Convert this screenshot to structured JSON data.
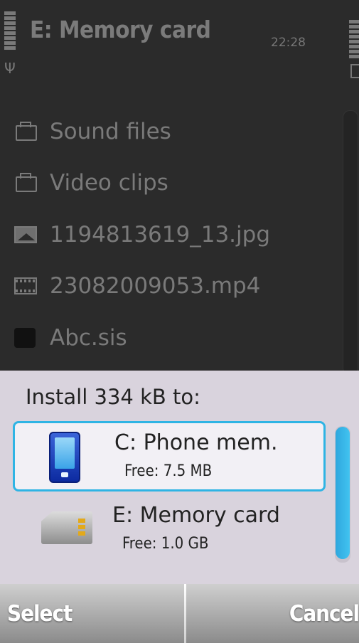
{
  "statusbar": {
    "title": "E: Memory card",
    "time": "22:28"
  },
  "files": [
    {
      "label": "Sound files",
      "icon": "folder-icon"
    },
    {
      "label": "Video clips",
      "icon": "folder-icon"
    },
    {
      "label": "1194813619_13.jpg",
      "icon": "image-icon"
    },
    {
      "label": "23082009053.mp4",
      "icon": "video-icon"
    },
    {
      "label": "Abc.sis",
      "icon": "sis-icon"
    }
  ],
  "dialog": {
    "title": "Install 334 kB to:",
    "options": [
      {
        "name": "C: Phone mem.",
        "free": "Free: 7.5 MB",
        "icon": "phone-icon",
        "selected": true
      },
      {
        "name": "E: Memory card",
        "free": "Free: 1.0 GB",
        "icon": "memory-card-icon",
        "selected": false
      }
    ]
  },
  "softkeys": {
    "left": "Select",
    "right": "Cancel"
  },
  "colors": {
    "accent": "#2fb4e4",
    "dialog_bg": "#d9d3dd",
    "background": "#2b2b2b"
  }
}
